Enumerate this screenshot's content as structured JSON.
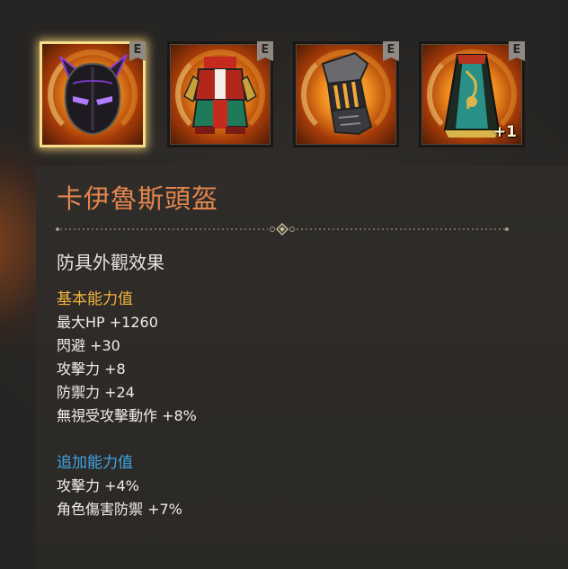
{
  "slots": [
    {
      "name": "helmet",
      "badge": "E",
      "enhance": "",
      "selected": true
    },
    {
      "name": "armor",
      "badge": "E",
      "enhance": "",
      "selected": false
    },
    {
      "name": "gloves",
      "badge": "E",
      "enhance": "",
      "selected": false
    },
    {
      "name": "cape",
      "badge": "E",
      "enhance": "+1",
      "selected": false
    }
  ],
  "item": {
    "title": "卡伊魯斯頭盔",
    "subtitle": "防具外觀效果"
  },
  "base_stats": {
    "heading": "基本能力值",
    "lines": [
      "最大HP +1260",
      "閃避 +30",
      "攻擊力 +8",
      "防禦力 +24",
      "無視受攻擊動作 +8%"
    ]
  },
  "extra_stats": {
    "heading": "追加能力值",
    "lines": [
      "攻擊力 +4%",
      "角色傷害防禦 +7%"
    ]
  },
  "colors": {
    "title": "#e3864e",
    "base_heading": "#f2b43c",
    "extra_heading": "#3fa4e4",
    "selected_border": "#f6dd8a"
  }
}
